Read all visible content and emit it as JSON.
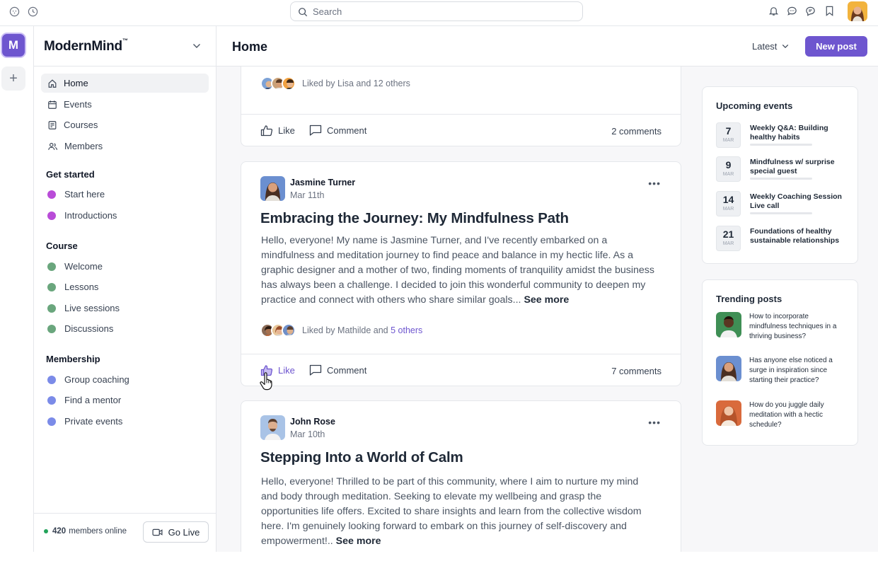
{
  "search": {
    "placeholder": "Search"
  },
  "rail": {
    "community_initial": "M",
    "add_label": "+"
  },
  "sidebar": {
    "brand": "ModernMind",
    "brand_mark": "™",
    "nav": [
      {
        "label": "Home"
      },
      {
        "label": "Events"
      },
      {
        "label": "Courses"
      },
      {
        "label": "Members"
      }
    ],
    "sections": [
      {
        "title": "Get started",
        "items": [
          {
            "label": "Start here",
            "color": "#b94cd8"
          },
          {
            "label": "Introductions",
            "color": "#b94cd8"
          }
        ]
      },
      {
        "title": "Course",
        "items": [
          {
            "label": "Welcome",
            "color": "#6aa67d"
          },
          {
            "label": "Lessons",
            "color": "#6aa67d"
          },
          {
            "label": "Live sessions",
            "color": "#6aa67d"
          },
          {
            "label": "Discussions",
            "color": "#6aa67d"
          }
        ]
      },
      {
        "title": "Membership",
        "items": [
          {
            "label": "Group coaching",
            "color": "#7b8be8"
          },
          {
            "label": "Find a mentor",
            "color": "#7b8be8"
          },
          {
            "label": "Private events",
            "color": "#7b8be8"
          }
        ]
      }
    ],
    "members_online_count": "420",
    "members_online_label": "members online",
    "go_live_label": "Go Live"
  },
  "header": {
    "title": "Home",
    "sort_label": "Latest",
    "new_post_label": "New post"
  },
  "feed": {
    "post0": {
      "liked_by": "Liked by Lisa and 12 others",
      "like_label": "Like",
      "comment_label": "Comment",
      "comments_count": "2 comments"
    },
    "post1": {
      "author": "Jasmine Turner",
      "date": "Mar 11th",
      "title": "Embracing the Journey: My Mindfulness Path",
      "body": "Hello, everyone! My name is Jasmine Turner, and I've recently embarked on a mindfulness and meditation journey to find peace and balance in my hectic life. As a graphic designer and a mother of two, finding moments of tranquility amidst the business has always been a challenge. I decided to join this wonderful community to deepen my practice and connect with others who share similar goals...",
      "see_more": "See more",
      "liked_by_prefix": "Liked by Mathilde and",
      "liked_by_link": "5 others",
      "like_label": "Like",
      "comment_label": "Comment",
      "comments_count": "7 comments"
    },
    "post2": {
      "author": "John Rose",
      "date": "Mar 10th",
      "title": "Stepping Into a World of Calm",
      "body": "Hello, everyone! Thrilled to be part of this community, where I aim to nurture my mind and body through meditation. Seeking to elevate my wellbeing and grasp the opportunities life offers. Excited to share insights and learn from the collective wisdom here. I'm genuinely looking forward to embark on this journey of self-discovery and empowerment!..",
      "see_more": "See more"
    }
  },
  "upcoming_events": {
    "title": "Upcoming events",
    "items": [
      {
        "day": "7",
        "month": "MAR",
        "title": "Weekly Q&A: Building healthy habits"
      },
      {
        "day": "9",
        "month": "MAR",
        "title": "Mindfulness w/ surprise special guest"
      },
      {
        "day": "14",
        "month": "MAR",
        "title": "Weekly Coaching Session Live call"
      },
      {
        "day": "21",
        "month": "MAR",
        "title": "Foundations of healthy sustainable relationships"
      }
    ]
  },
  "trending_posts": {
    "title": "Trending posts",
    "items": [
      {
        "text": "How to incorporate mindfulness techniques in a thriving business?"
      },
      {
        "text": "Has anyone else noticed a surge in inspiration since starting their practice?"
      },
      {
        "text": "How do you juggle daily meditation with a hectic schedule?"
      }
    ]
  },
  "colors": {
    "accent": "#6e56cf",
    "online": "#22a35a"
  }
}
